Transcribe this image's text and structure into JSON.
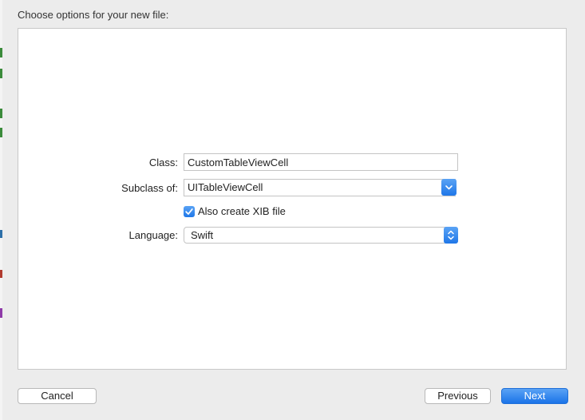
{
  "dialog": {
    "heading": "Choose options for your new file:"
  },
  "form": {
    "class_label": "Class:",
    "class_value": "CustomTableViewCell",
    "subclass_label": "Subclass of:",
    "subclass_value": "UITableViewCell",
    "xib_checkbox_label": "Also create XIB file",
    "xib_checked": true,
    "language_label": "Language:",
    "language_value": "Swift"
  },
  "buttons": {
    "cancel": "Cancel",
    "previous": "Previous",
    "next": "Next"
  },
  "colors": {
    "accent": "#1f77e8",
    "panel_background": "#ffffff",
    "window_background": "#ececec"
  }
}
